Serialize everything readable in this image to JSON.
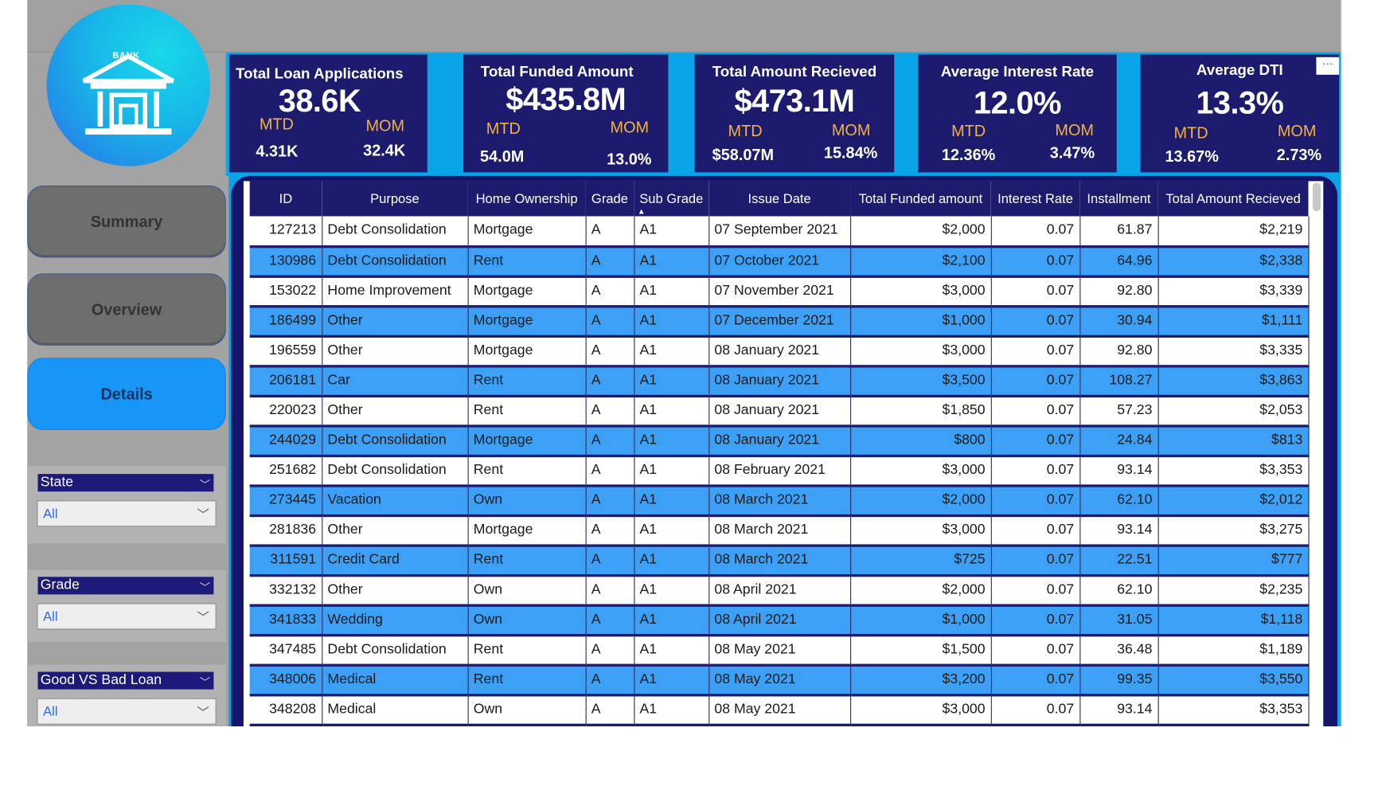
{
  "sidebar": {
    "logo_text": "BANK",
    "nav": [
      {
        "label": "Summary",
        "active": false
      },
      {
        "label": "Overview",
        "active": false
      },
      {
        "label": "Details",
        "active": true
      }
    ],
    "slicers": [
      {
        "title": "State",
        "value": "All"
      },
      {
        "title": "Grade",
        "value": "All"
      },
      {
        "title": "Good VS Bad Loan",
        "value": "All"
      }
    ]
  },
  "kpis": [
    {
      "title": "Total Loan  Applications",
      "value": "38.6K",
      "mtd_label": "MTD",
      "mom_label": "MOM",
      "mtd": "4.31K",
      "mom": "32.4K"
    },
    {
      "title": "Total Funded Amount",
      "value": "$435.8M",
      "mtd_label": "MTD",
      "mom_label": "MOM",
      "mtd": "54.0M",
      "mom": "13.0%"
    },
    {
      "title": "Total Amount Recieved",
      "value": "$473.1M",
      "mtd_label": "MTD",
      "mom_label": "MOM",
      "mtd": "$58.07M",
      "mom": "15.84%"
    },
    {
      "title": "Average Interest Rate",
      "value": "12.0%",
      "mtd_label": "MTD",
      "mom_label": "MOM",
      "mtd": "12.36%",
      "mom": "3.47%"
    },
    {
      "title": "Average DTI",
      "value": "13.3%",
      "mtd_label": "MTD",
      "mom_label": "MOM",
      "mtd": "13.67%",
      "mom": "2.73%"
    }
  ],
  "menu_dots": "···",
  "table": {
    "columns": [
      "ID",
      "Purpose",
      "Home Ownership",
      "Grade",
      "Sub Grade",
      "Issue Date",
      "Total Funded amount",
      "Interest Rate",
      "Installment",
      "Total Amount Recieved"
    ],
    "sorted_column": "Sub Grade",
    "rows": [
      [
        "127213",
        "Debt Consolidation",
        "Mortgage",
        "A",
        "A1",
        "07 September 2021",
        "$2,000",
        "0.07",
        "61.87",
        "$2,219"
      ],
      [
        "130986",
        "Debt Consolidation",
        "Rent",
        "A",
        "A1",
        "07 October 2021",
        "$2,100",
        "0.07",
        "64.96",
        "$2,338"
      ],
      [
        "153022",
        "Home Improvement",
        "Mortgage",
        "A",
        "A1",
        "07 November 2021",
        "$3,000",
        "0.07",
        "92.80",
        "$3,339"
      ],
      [
        "186499",
        "Other",
        "Mortgage",
        "A",
        "A1",
        "07 December 2021",
        "$1,000",
        "0.07",
        "30.94",
        "$1,111"
      ],
      [
        "196559",
        "Other",
        "Mortgage",
        "A",
        "A1",
        "08 January 2021",
        "$3,000",
        "0.07",
        "92.80",
        "$3,335"
      ],
      [
        "206181",
        "Car",
        "Rent",
        "A",
        "A1",
        "08 January 2021",
        "$3,500",
        "0.07",
        "108.27",
        "$3,863"
      ],
      [
        "220023",
        "Other",
        "Rent",
        "A",
        "A1",
        "08 January 2021",
        "$1,850",
        "0.07",
        "57.23",
        "$2,053"
      ],
      [
        "244029",
        "Debt Consolidation",
        "Mortgage",
        "A",
        "A1",
        "08 January 2021",
        "$800",
        "0.07",
        "24.84",
        "$813"
      ],
      [
        "251682",
        "Debt Consolidation",
        "Rent",
        "A",
        "A1",
        "08 February 2021",
        "$3,000",
        "0.07",
        "93.14",
        "$3,353"
      ],
      [
        "273445",
        "Vacation",
        "Own",
        "A",
        "A1",
        "08 March 2021",
        "$2,000",
        "0.07",
        "62.10",
        "$2,012"
      ],
      [
        "281836",
        "Other",
        "Mortgage",
        "A",
        "A1",
        "08 March 2021",
        "$3,000",
        "0.07",
        "93.14",
        "$3,275"
      ],
      [
        "311591",
        "Credit Card",
        "Rent",
        "A",
        "A1",
        "08 March 2021",
        "$725",
        "0.07",
        "22.51",
        "$777"
      ],
      [
        "332132",
        "Other",
        "Own",
        "A",
        "A1",
        "08 April 2021",
        "$2,000",
        "0.07",
        "62.10",
        "$2,235"
      ],
      [
        "341833",
        "Wedding",
        "Own",
        "A",
        "A1",
        "08 April 2021",
        "$1,000",
        "0.07",
        "31.05",
        "$1,118"
      ],
      [
        "347485",
        "Debt Consolidation",
        "Rent",
        "A",
        "A1",
        "08 May 2021",
        "$1,500",
        "0.07",
        "36.48",
        "$1,189"
      ],
      [
        "348006",
        "Medical",
        "Rent",
        "A",
        "A1",
        "08 May 2021",
        "$3,200",
        "0.07",
        "99.35",
        "$3,550"
      ],
      [
        "348208",
        "Medical",
        "Own",
        "A",
        "A1",
        "08 May 2021",
        "$3,000",
        "0.07",
        "93.14",
        "$3,353"
      ]
    ]
  },
  "colors": {
    "navy": "#1d1b6e",
    "accent_blue": "#0aa4e8",
    "row_blue": "#3ca0f6",
    "kpi_label": "#f3b33d",
    "active_nav": "#1796f7"
  }
}
